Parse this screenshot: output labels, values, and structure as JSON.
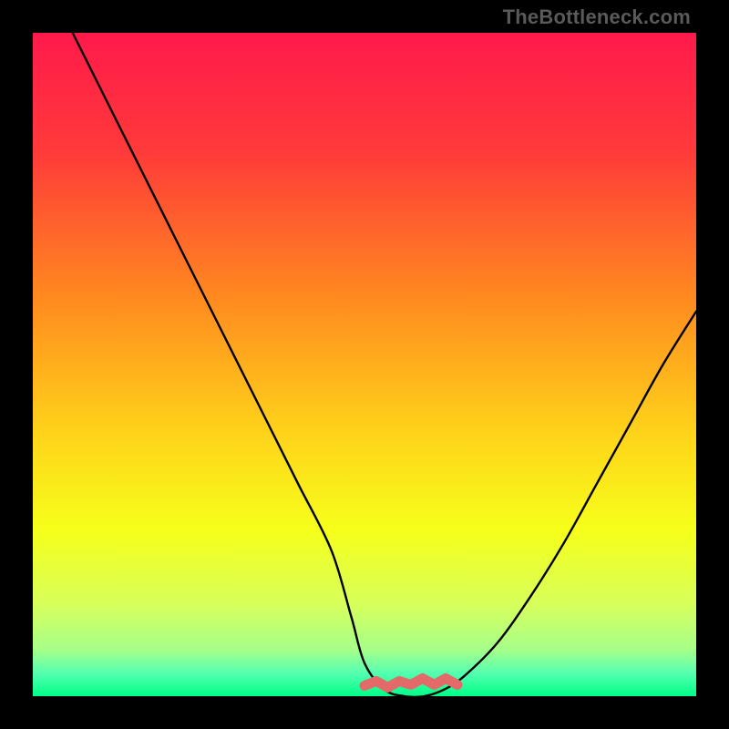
{
  "watermark": "TheBottleneck.com",
  "colors": {
    "frame": "#000000",
    "curve": "#000000",
    "squiggle": "#e46a6a",
    "gradient_stops": [
      {
        "offset": 0.0,
        "color": "#ff1a4b"
      },
      {
        "offset": 0.18,
        "color": "#ff3a3a"
      },
      {
        "offset": 0.4,
        "color": "#ff8a1f"
      },
      {
        "offset": 0.6,
        "color": "#ffd21a"
      },
      {
        "offset": 0.75,
        "color": "#f6ff1a"
      },
      {
        "offset": 0.86,
        "color": "#d8ff5a"
      },
      {
        "offset": 0.93,
        "color": "#a6ff8a"
      },
      {
        "offset": 0.965,
        "color": "#55ffb0"
      },
      {
        "offset": 1.0,
        "color": "#00ff88"
      }
    ]
  },
  "chart_data": {
    "type": "line",
    "title": "",
    "xlabel": "",
    "ylabel": "",
    "xlim": [
      0,
      100
    ],
    "ylim": [
      0,
      100
    ],
    "series": [
      {
        "name": "bottleneck-curve",
        "x": [
          6,
          10,
          15,
          20,
          25,
          30,
          35,
          40,
          45,
          48,
          50,
          53,
          56,
          59,
          62,
          65,
          70,
          75,
          80,
          85,
          90,
          95,
          100
        ],
        "y": [
          100,
          92,
          82,
          72,
          62,
          52,
          42,
          32,
          22,
          12,
          5,
          1,
          0,
          0,
          1,
          3,
          8,
          15,
          23,
          32,
          41,
          50,
          58
        ]
      }
    ],
    "annotations": [
      {
        "name": "valley-squiggle",
        "x_range": [
          50,
          64
        ],
        "y": 2,
        "note": "hand-drawn marker at curve minimum"
      }
    ]
  }
}
